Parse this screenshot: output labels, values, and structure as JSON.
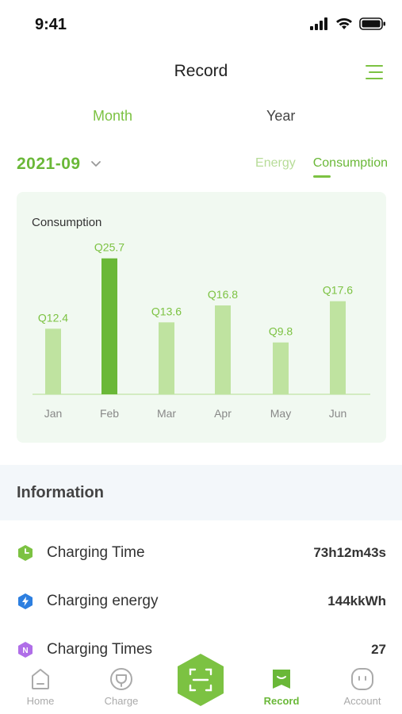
{
  "status_bar": {
    "time": "9:41"
  },
  "header": {
    "title": "Record"
  },
  "period_tabs": {
    "month": "Month",
    "year": "Year",
    "selected": "Month"
  },
  "date_selector": {
    "value": "2021-09"
  },
  "metric_tabs": {
    "energy": "Energy",
    "consumption": "Consumption",
    "selected": "Consumption"
  },
  "colors": {
    "accent": "#7cc242",
    "bar_light": "#bfe3a0",
    "bar_dark": "#6ab838",
    "card_bg": "#f1f9f1"
  },
  "chart_data": {
    "type": "bar",
    "title": "Consumption",
    "categories": [
      "Jan",
      "Feb",
      "Mar",
      "Apr",
      "May",
      "Jun"
    ],
    "values": [
      12.4,
      25.7,
      13.6,
      16.8,
      9.8,
      17.6
    ],
    "data_labels": [
      "Q12.4",
      "Q25.7",
      "Q13.6",
      "Q16.8",
      "Q9.8",
      "Q17.6"
    ],
    "highlighted_index": 1,
    "ylim": [
      0,
      27
    ],
    "xlabel": "",
    "ylabel": "",
    "grid": false
  },
  "information": {
    "title": "Information",
    "rows": [
      {
        "icon": "clock-icon",
        "label": "Charging Time",
        "value": "73h12m43s",
        "color": "#7cc242"
      },
      {
        "icon": "lightning-icon",
        "label": "Charging energy",
        "value": "144kkWh",
        "color": "#2d7fe0"
      },
      {
        "icon": "n-icon",
        "label": "Charging Times",
        "value": "27",
        "color": "#b06ee8"
      }
    ]
  },
  "tab_bar": {
    "items": [
      {
        "label": "Home",
        "icon": "home-icon",
        "active": false
      },
      {
        "label": "Charge",
        "icon": "charge-icon",
        "active": false
      },
      {
        "label": "",
        "icon": "scan-icon",
        "active": false
      },
      {
        "label": "Record",
        "icon": "record-icon",
        "active": true
      },
      {
        "label": "Account",
        "icon": "account-icon",
        "active": false
      }
    ]
  }
}
